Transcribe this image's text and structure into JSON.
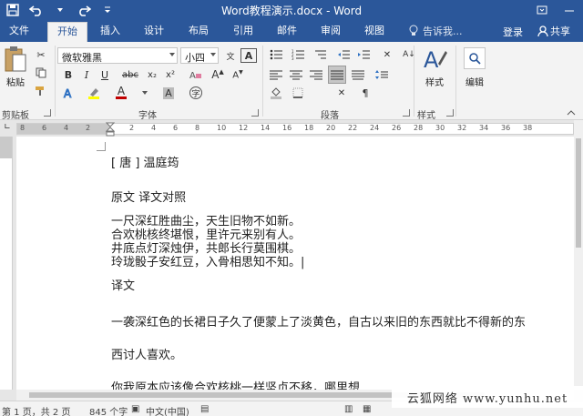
{
  "window": {
    "title": "Word教程演示.docx - Word"
  },
  "colors": {
    "brand": "#2b579a",
    "ribbon_bg": "#f3f3f3",
    "font_color_red": "#c00000",
    "highlight_yellow": "#ffff00"
  },
  "tabs": [
    {
      "label": "文件"
    },
    {
      "label": "开始",
      "active": true
    },
    {
      "label": "插入"
    },
    {
      "label": "设计"
    },
    {
      "label": "布局"
    },
    {
      "label": "引用"
    },
    {
      "label": "邮件"
    },
    {
      "label": "审阅"
    },
    {
      "label": "视图"
    }
  ],
  "header": {
    "tell_me": "告诉我...",
    "login": "登录",
    "share": "共享"
  },
  "ribbon": {
    "clipboard": {
      "paste": "粘贴",
      "label": "剪贴板"
    },
    "font": {
      "name": "微软雅黑",
      "size": "小四",
      "bold": "B",
      "italic": "I",
      "underline": "U",
      "strike": "abc",
      "subscript": "x₂",
      "superscript": "x²",
      "font_letter": "A",
      "phonetic": "文",
      "border_char": "A",
      "label": "字体"
    },
    "paragraph": {
      "label": "段落"
    },
    "styles": {
      "button": "样式",
      "label": "样式"
    },
    "editing": {
      "button": "编辑"
    }
  },
  "ruler": {
    "numbers": [
      "8",
      "6",
      "4",
      "2",
      "2",
      "4",
      "6",
      "8",
      "10",
      "12",
      "14",
      "16",
      "18",
      "20",
      "22",
      "24",
      "26",
      "28",
      "30",
      "32",
      "34",
      "36",
      "38"
    ]
  },
  "document": {
    "lines": [
      "[ 唐 ] 温庭筠",
      "原文  译文对照",
      "一尺深红胜曲尘，天生旧物不如新。",
      "合欢桃核终堪恨，里许元来别有人。",
      "井底点灯深烛伊，共郎长行莫围棋。",
      "玲珑骰子安红豆，入骨相思知不知。|",
      "译文",
      "一袭深红色的长裙日子久了便蒙上了淡黄色，自古以来旧的东西就比不得新的东",
      "西讨人喜欢。",
      "你我原本应该像合欢核桃一样坚贞不移，哪里想"
    ]
  },
  "status": {
    "page": "第 1 页，共 2 页",
    "words": "845 个字",
    "lang": "中文(中国)"
  },
  "watermark": "云狐网络 www.yunhu.net"
}
